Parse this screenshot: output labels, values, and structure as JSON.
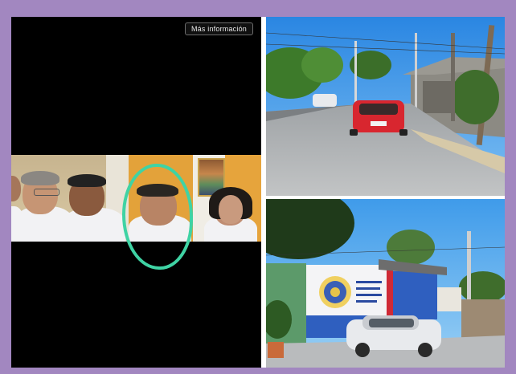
{
  "video": {
    "more_info_label": "Más información"
  },
  "colors": {
    "background": "#a287c0",
    "highlight_circle": "#3fd3a4",
    "car_red": "#d8262f",
    "car_white": "#e8eaed",
    "sky": "#2f8fe6"
  },
  "icons": {
    "seal": "seal-emblem-icon"
  }
}
